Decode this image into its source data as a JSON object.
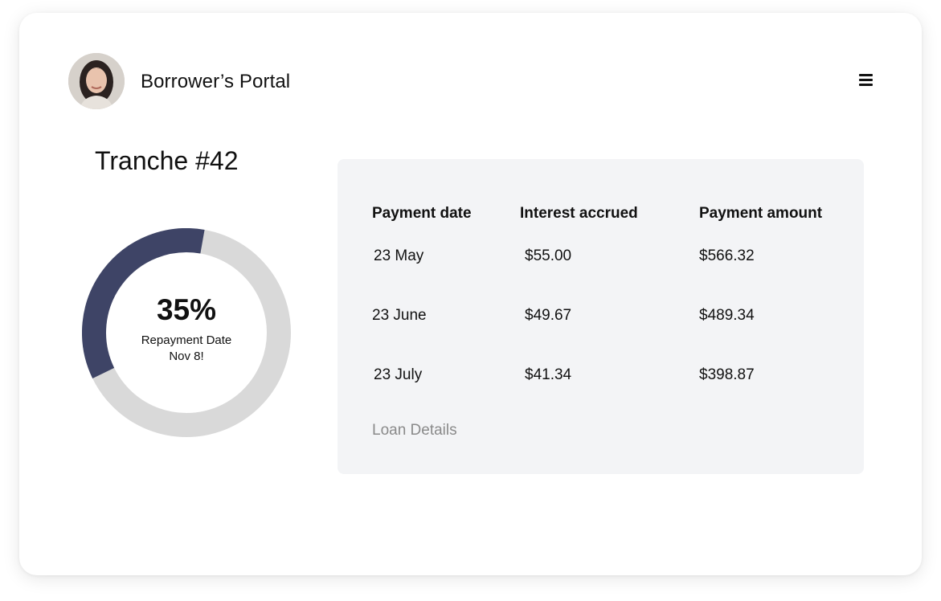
{
  "header": {
    "title": "Borrower’s Portal"
  },
  "tranche": {
    "title": "Tranche #42"
  },
  "progress": {
    "value_percent": 35,
    "label": "35%",
    "caption_line1": "Repayment Date",
    "caption_line2": "Nov 8!",
    "fill_color": "#3e4466",
    "track_color": "#d9d9d9"
  },
  "schedule": {
    "columns": [
      "Payment date",
      "Interest accrued",
      "Payment amount"
    ],
    "rows": [
      [
        "23 May",
        "$55.00",
        "$566.32"
      ],
      [
        "23 June",
        "$49.67",
        "$489.34"
      ],
      [
        "23 July",
        "$41.34",
        "$398.87"
      ]
    ]
  },
  "loan_details_link": "Loan Details",
  "icons": {
    "menu": "hamburger-menu-icon",
    "avatar": "user-avatar"
  }
}
